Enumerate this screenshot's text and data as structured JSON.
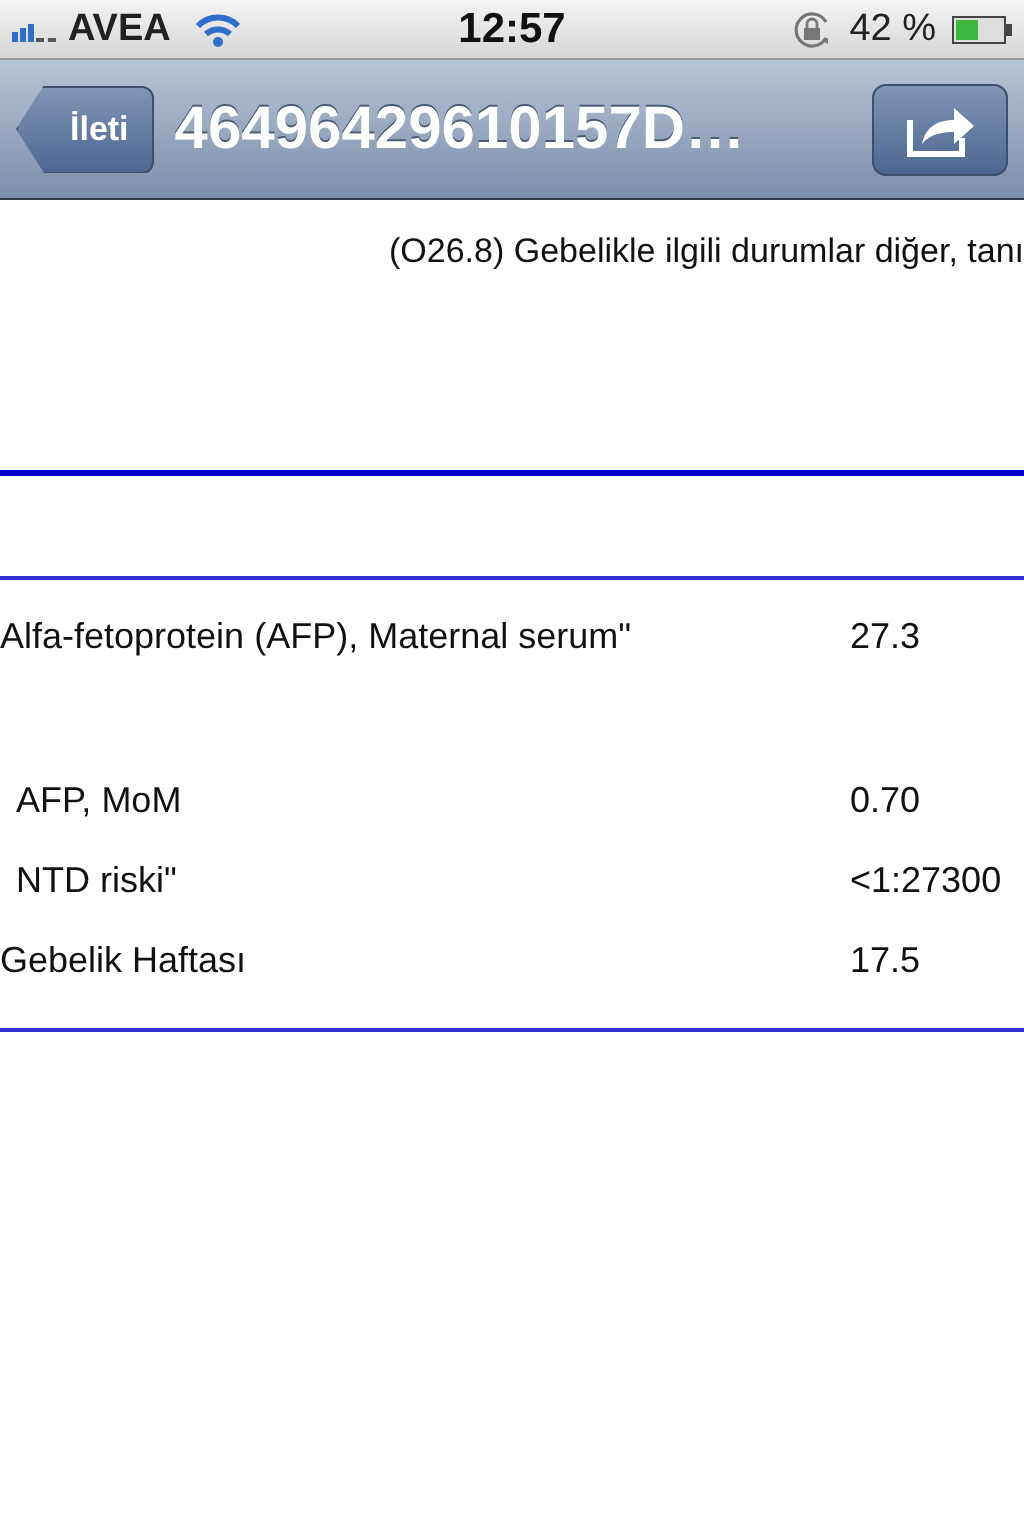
{
  "status_bar": {
    "carrier": "AVEA",
    "time": "12:57",
    "battery": "42 %"
  },
  "nav_bar": {
    "back": "İleti",
    "title": "46496429610157D…"
  },
  "diagnosis": "(O26.8) Gebelikle ilgili durumlar diğer, tanı",
  "results": [
    {
      "kind": "result",
      "label": "Alfa-fetoprotein (AFP), Maternal serum\"",
      "value": "27.3",
      "indented": false
    },
    {
      "kind": "blank"
    },
    {
      "kind": "result",
      "label": "AFP, MoM",
      "value": "0.70",
      "indented": true
    },
    {
      "kind": "result",
      "label": "NTD riski\"",
      "value": "<1:27300",
      "indented": true
    },
    {
      "kind": "result",
      "label": "Gebelik Haftası",
      "value": "17.5",
      "indented": false
    }
  ]
}
